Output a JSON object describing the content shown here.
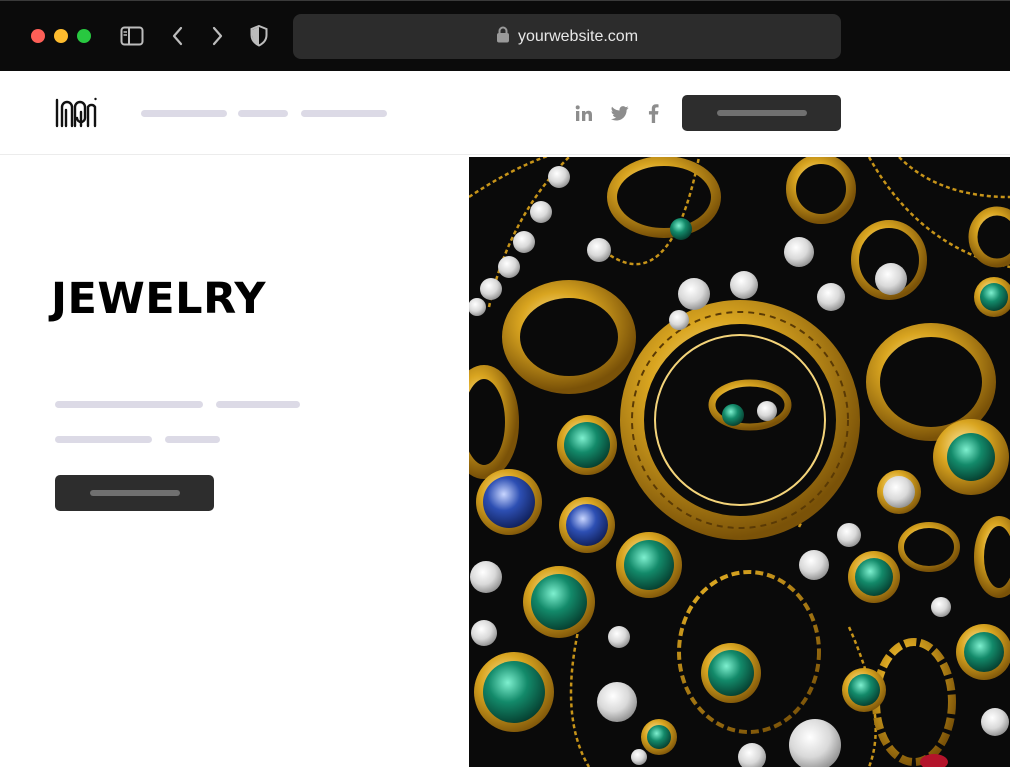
{
  "browser": {
    "url": "yourwebsite.com",
    "icons": [
      "sidebar-icon",
      "back-icon",
      "forward-icon",
      "shield-icon",
      "lock-icon"
    ]
  },
  "header": {
    "logo": "logo",
    "social": [
      "linkedin-icon",
      "twitter-icon",
      "facebook-icon"
    ]
  },
  "hero": {
    "title": "JEWELRY",
    "image": "jewelry-collection-photo"
  },
  "colors": {
    "dark_button": "#2d2d2d",
    "placeholder": "#dcdae6",
    "gold": "#d4a017",
    "emerald": "#138a6a",
    "sapphire": "#2d4fb3"
  }
}
